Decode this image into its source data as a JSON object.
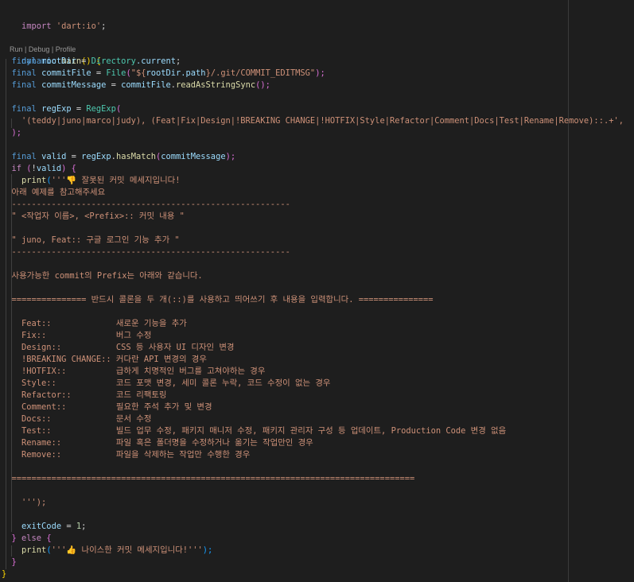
{
  "code": {
    "import": {
      "kw": "import",
      "str": "'dart:io'",
      "semi": ";"
    },
    "codelens": {
      "run": "Run",
      "sep1": " | ",
      "debug": "Debug",
      "sep2": " | ",
      "profile": "Profile"
    },
    "main_sig": {
      "kw": "dynamic",
      "fn": "main",
      "rest": "() {"
    },
    "rootdir": {
      "kw": "final",
      "var": "rootDir",
      "op": " = ",
      "cls": "Directory",
      "prop": ".current",
      "semi": ";"
    },
    "commitfile": {
      "kw": "final",
      "var": "commitFile",
      "op": " = ",
      "cls": "File",
      "open": "(",
      "str1": "\"${",
      "inner": "rootDir.path",
      "str2": "}/.git/COMMIT_EDITMSG\"",
      "close": ");"
    },
    "commitmsg": {
      "kw": "final",
      "var": "commitMessage",
      "op": " = ",
      "obj": "commitFile",
      "dot": ".",
      "fn": "readAsStringSync",
      "close": "();"
    },
    "regexp": {
      "kw": "final",
      "var": "regExp",
      "op": " = ",
      "cls": "RegExp",
      "open": "("
    },
    "regexp_str": "'(teddy|juno|marco|judy), (Feat|Fix|Design|!BREAKING CHANGE|!HOTFIX|Style|Refactor|Comment|Docs|Test|Rename|Remove)::.+',",
    "regexp_close": ");",
    "valid": {
      "kw": "final",
      "var": "valid",
      "op": " = ",
      "obj": "regExp",
      "dot": ".",
      "fn": "hasMatch",
      "open": "(",
      "arg": "commitMessage",
      "close": ");"
    },
    "if_line": {
      "kw": "if",
      "open": " (",
      "not": "!",
      "var": "valid",
      "close": ") {"
    },
    "print1": {
      "fn": "print",
      "open": "(",
      "str": "'''👎 잘못된 커밋 메세지입니다!"
    },
    "body_lines": [
      "아래 예제를 참고해주세요",
      "--------------------------------------------------------",
      "\" <작업자 이름>, <Prefix>:: 커밋 내용 \"",
      "",
      "\" juno, Feat:: 구글 로그인 기능 추가 \"",
      "--------------------------------------------------------",
      "",
      "사용가능한 commit의 Prefix는 아래와 같습니다.",
      "",
      "=============== 반드시 콜론을 두 개(::)를 사용하고 띄어쓰기 후 내용을 입력합니다. ===============",
      "",
      "  Feat::             새로운 기능을 추가",
      "  Fix::              버그 수정",
      "  Design::           CSS 등 사용자 UI 디자인 변경",
      "  !BREAKING CHANGE:: 커다란 API 변경의 경우",
      "  !HOTFIX::          급하게 치명적인 버그를 고쳐야하는 경우",
      "  Style::            코드 포맷 변경, 세미 콜론 누락, 코드 수정이 없는 경우",
      "  Refactor::         코드 리팩토링",
      "  Comment::          필요한 주석 추가 및 변경",
      "  Docs::             문서 수정",
      "  Test::             빌드 업무 수정, 패키지 매니저 수정, 패키지 관리자 구성 등 업데이트, Production Code 변경 없음",
      "  Rename::           파일 혹은 폴더명을 수정하거나 옮기는 작업만인 경우",
      "  Remove::           파일을 삭제하는 작업만 수행한 경우",
      "",
      "=================================================================================",
      "",
      "  ''');"
    ],
    "exitcode": {
      "var": "exitCode",
      "op": " = ",
      "num": "1",
      "semi": ";"
    },
    "else_line": {
      "close": "} ",
      "kw": "else",
      "open": " {"
    },
    "print2": {
      "fn": "print",
      "open": "(",
      "str": "'''👍 나이스한 커밋 메세지입니다!'''",
      "close": ");"
    },
    "close_if": "}",
    "close_main": "}"
  }
}
